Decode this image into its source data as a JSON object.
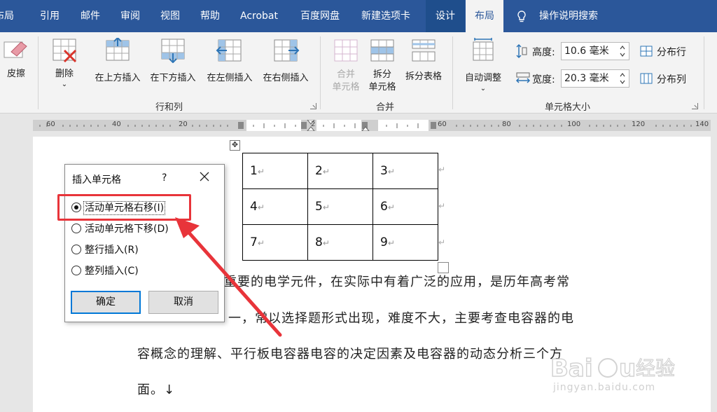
{
  "tabs": {
    "layout_partial": "布局",
    "references": "引用",
    "mailings": "邮件",
    "review": "审阅",
    "view": "视图",
    "help": "帮助",
    "acrobat": "Acrobat",
    "baidu": "百度网盘",
    "newtab": "新建选项卡",
    "design": "设计",
    "layout": "布局",
    "tellme": "操作说明搜索"
  },
  "ribbon": {
    "eraser": "皮擦",
    "delete": "删除",
    "insert_above": "在上方插入",
    "insert_below": "在下方插入",
    "insert_left": "在左侧插入",
    "insert_right": "在右侧插入",
    "group_rows_cols": "行和列",
    "merge_cells_1": "合并",
    "merge_cells_2": "单元格",
    "split_cells_1": "拆分",
    "split_cells_2": "单元格",
    "split_table": "拆分表格",
    "group_merge": "合并",
    "autofit": "自动调整",
    "height_label": "高度:",
    "height_value": "10.6 毫米",
    "width_label": "宽度:",
    "width_value": "20.3 毫米",
    "distribute_rows": "分布行",
    "distribute_cols": "分布列",
    "group_cell_size": "单元格大小"
  },
  "ruler": {
    "left_nums": [
      "60",
      "40",
      "20",
      "2"
    ],
    "right_nums": [
      "60",
      "80",
      "100",
      "120",
      "140"
    ]
  },
  "table": {
    "rows": [
      [
        "1",
        "2",
        "3"
      ],
      [
        "4",
        "5",
        "6"
      ],
      [
        "7",
        "8",
        "9"
      ]
    ]
  },
  "paragraph": {
    "line1": "重要的电学元件，在实际中有着广泛的应用，是历年高考常",
    "line2": "一，常以选择题形式出现，难度不大，主要考查电容器的电",
    "line3": "容概念的理解、平行板电容器电容的决定因素及电容器的动态分析三个方",
    "line4": "面。↓"
  },
  "dialog": {
    "title": "插入单元格",
    "help": "?",
    "options": [
      {
        "label": "活动单元格右移(I)",
        "selected": true
      },
      {
        "label": "活动单元格下移(D)",
        "selected": false
      },
      {
        "label": "整行插入(R)",
        "selected": false
      },
      {
        "label": "整列插入(C)",
        "selected": false
      }
    ],
    "ok": "确定",
    "cancel": "取消"
  },
  "watermark": {
    "brand": "Baidu 经验",
    "url": "jingyan.baidu.com"
  },
  "colors": {
    "tabbar": "#2b579a",
    "annotation": "#e8343a"
  }
}
